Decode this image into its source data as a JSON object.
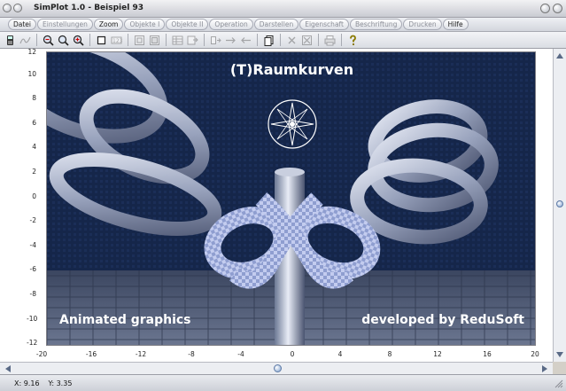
{
  "window": {
    "title": "SimPlot 1.0 - Beispiel 93"
  },
  "menu": [
    {
      "label": "Datei",
      "enabled": true
    },
    {
      "label": "Einstellungen",
      "enabled": false
    },
    {
      "label": "Zoom",
      "enabled": true
    },
    {
      "label": "Objekte I",
      "enabled": false
    },
    {
      "label": "Objekte II",
      "enabled": false
    },
    {
      "label": "Operation",
      "enabled": false
    },
    {
      "label": "Darstellen",
      "enabled": false
    },
    {
      "label": "Eigenschaft",
      "enabled": false
    },
    {
      "label": "Beschriftung",
      "enabled": false
    },
    {
      "label": "Drucken",
      "enabled": false
    },
    {
      "label": "Hilfe",
      "enabled": true
    }
  ],
  "toolbar": [
    {
      "icon": "calculator-icon",
      "enabled": true
    },
    {
      "icon": "function-icon",
      "enabled": false
    },
    {
      "icon": "zoom-out-icon",
      "enabled": true
    },
    {
      "icon": "zoom-icon",
      "enabled": true
    },
    {
      "icon": "zoom-in-icon",
      "enabled": true
    },
    {
      "icon": "frame-icon",
      "enabled": true
    },
    {
      "icon": "numbers-icon",
      "enabled": false
    },
    {
      "icon": "grid-a-icon",
      "enabled": false
    },
    {
      "icon": "grid-b-icon",
      "enabled": false
    },
    {
      "icon": "table-icon",
      "enabled": false
    },
    {
      "icon": "export-icon",
      "enabled": false
    },
    {
      "icon": "copy-left-icon",
      "enabled": false
    },
    {
      "icon": "arrow-right-icon",
      "enabled": false
    },
    {
      "icon": "arrow-left-icon",
      "enabled": false
    },
    {
      "icon": "pages-icon",
      "enabled": true
    },
    {
      "icon": "delete-icon",
      "enabled": false
    },
    {
      "icon": "delete-all-icon",
      "enabled": false
    },
    {
      "icon": "print-icon",
      "enabled": false
    },
    {
      "icon": "help-icon",
      "enabled": true
    }
  ],
  "plot": {
    "y_ticks": [
      "12",
      "10",
      "8",
      "6",
      "4",
      "2",
      "0",
      "-2",
      "-4",
      "-6",
      "-8",
      "-10",
      "-12"
    ],
    "x_ticks": [
      "-20",
      "-16",
      "-12",
      "-8",
      "-4",
      "0",
      "4",
      "8",
      "12",
      "16",
      "20"
    ],
    "scene": {
      "title": "(T)Raumkurven",
      "caption_left": "Animated graphics",
      "caption_right": "developed by ReduSoft"
    }
  },
  "status": {
    "x": "X: 9.16",
    "y": "Y: 3.35"
  }
}
